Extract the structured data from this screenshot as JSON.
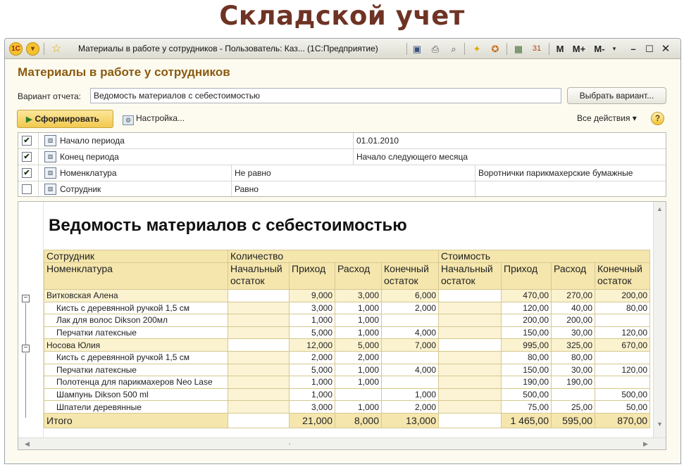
{
  "banner": "Складской учет",
  "window": {
    "title": "Материалы в работе у сотрудников - Пользователь: Каз... (1С:Предприятие)",
    "mem_buttons": [
      "M",
      "M+",
      "M-"
    ]
  },
  "header": {
    "title": "Материалы в работе у сотрудников",
    "variant_label": "Вариант отчета:",
    "variant_value": "Ведомость материалов с себестоимостью",
    "variant_button": "Выбрать вариант...",
    "run_button": "Сформировать",
    "settings_button": "Настройка...",
    "all_actions": "Все действия ▾",
    "help": "?"
  },
  "filters": [
    {
      "checked": true,
      "field": "Начало периода",
      "condition": "",
      "value": "01.01.2010"
    },
    {
      "checked": true,
      "field": "Конец периода",
      "condition": "",
      "value": "Начало следующего месяца"
    },
    {
      "checked": true,
      "field": "Номенклатура",
      "condition": "Не равно",
      "value": "Воротнички парикмахерские бумажные"
    },
    {
      "checked": false,
      "field": "Сотрудник",
      "condition": "Равно",
      "value": ""
    }
  ],
  "report": {
    "title": "Ведомость материалов с себестоимостью",
    "head": {
      "employee": "Сотрудник",
      "nomenclature": "Номенклатура",
      "quantity": "Количество",
      "cost": "Стоимость",
      "cols": [
        "Начальный остаток",
        "Приход",
        "Расход",
        "Конечный остаток"
      ]
    },
    "groups": [
      {
        "name": "Витковская Алена",
        "q": [
          "",
          "9,000",
          "3,000",
          "6,000"
        ],
        "c": [
          "",
          "470,00",
          "270,00",
          "200,00"
        ],
        "items": [
          {
            "name": "Кисть с деревянной ручкой 1,5 см",
            "q": [
              "",
              "3,000",
              "1,000",
              "2,000"
            ],
            "c": [
              "",
              "120,00",
              "40,00",
              "80,00"
            ]
          },
          {
            "name": "Лак для волос Dikson 200мл",
            "q": [
              "",
              "1,000",
              "1,000",
              ""
            ],
            "c": [
              "",
              "200,00",
              "200,00",
              ""
            ]
          },
          {
            "name": "Перчатки латексные",
            "q": [
              "",
              "5,000",
              "1,000",
              "4,000"
            ],
            "c": [
              "",
              "150,00",
              "30,00",
              "120,00"
            ]
          }
        ]
      },
      {
        "name": "Носова Юлия",
        "q": [
          "",
          "12,000",
          "5,000",
          "7,000"
        ],
        "c": [
          "",
          "995,00",
          "325,00",
          "670,00"
        ],
        "items": [
          {
            "name": "Кисть с деревянной ручкой 1,5 см",
            "q": [
              "",
              "2,000",
              "2,000",
              ""
            ],
            "c": [
              "",
              "80,00",
              "80,00",
              ""
            ]
          },
          {
            "name": "Перчатки латексные",
            "q": [
              "",
              "5,000",
              "1,000",
              "4,000"
            ],
            "c": [
              "",
              "150,00",
              "30,00",
              "120,00"
            ]
          },
          {
            "name": "Полотенца для парикмахеров Neo Lase",
            "q": [
              "",
              "1,000",
              "1,000",
              ""
            ],
            "c": [
              "",
              "190,00",
              "190,00",
              ""
            ]
          },
          {
            "name": "Шампунь Dikson 500 ml",
            "q": [
              "",
              "1,000",
              "",
              "1,000"
            ],
            "c": [
              "",
              "500,00",
              "",
              "500,00"
            ]
          },
          {
            "name": "Шпатели деревянные",
            "q": [
              "",
              "3,000",
              "1,000",
              "2,000"
            ],
            "c": [
              "",
              "75,00",
              "25,00",
              "50,00"
            ]
          }
        ]
      }
    ],
    "total": {
      "label": "Итого",
      "q": [
        "",
        "21,000",
        "8,000",
        "13,000"
      ],
      "c": [
        "",
        "1 465,00",
        "595,00",
        "870,00"
      ]
    }
  }
}
